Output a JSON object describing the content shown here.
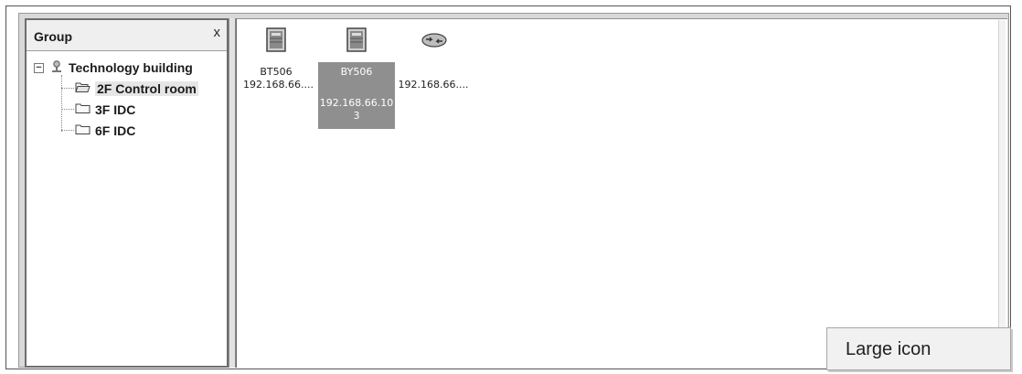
{
  "group_panel": {
    "title": "Group",
    "close": "x"
  },
  "tree": {
    "root": "Technology building",
    "children": [
      {
        "label": "2F Control  room",
        "selected": true
      },
      {
        "label": "3F IDC",
        "selected": false
      },
      {
        "label": "6F IDC",
        "selected": false
      }
    ]
  },
  "devices": [
    {
      "name": "BT506",
      "ip": "192.168.66....",
      "icon": "server-icon",
      "selected": false
    },
    {
      "name": "BY506",
      "ip_line1": "192.168.66.10",
      "ip_line2": "3",
      "icon": "server-icon",
      "selected": true
    },
    {
      "name": "",
      "ip": "192.168.66....",
      "icon": "network-device-icon",
      "selected": false
    }
  ],
  "tooltip": {
    "text": "Large icon"
  },
  "colors": {
    "selection": "#8f8f8f",
    "panel_border": "#6d6d6d"
  }
}
